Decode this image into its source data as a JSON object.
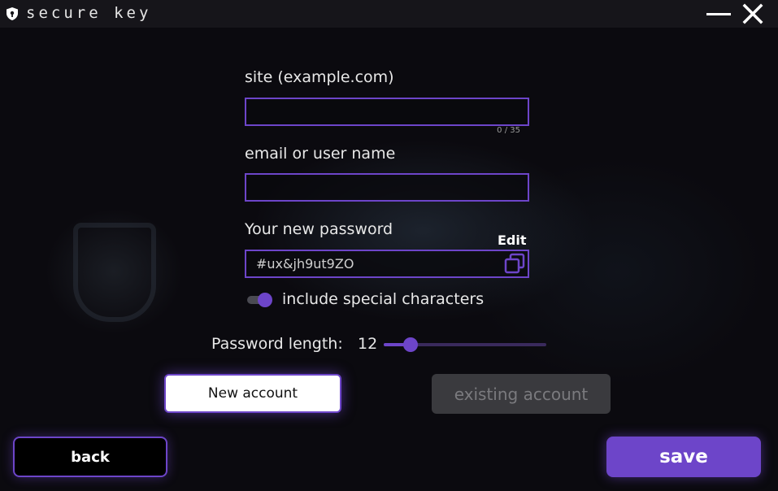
{
  "window": {
    "title": "secure key"
  },
  "form": {
    "site": {
      "label": "site (example.com)",
      "value": "",
      "placeholder": "",
      "counter": "0 / 35"
    },
    "username": {
      "label": "email or user name",
      "value": "",
      "placeholder": ""
    },
    "password": {
      "label": "Your new password",
      "value": "#ux&jh9ut9ZO",
      "edit_label": "Edit",
      "copy_icon": "copy-icon"
    },
    "special_chars": {
      "label": "include special characters",
      "enabled": true
    },
    "length": {
      "label": "Password length:",
      "value": "12",
      "min": 4,
      "max": 64,
      "current": 12
    }
  },
  "mode_buttons": {
    "new_label": "New account",
    "existing_label": "existing account",
    "selected": "new"
  },
  "footer": {
    "back_label": "back",
    "save_label": "save"
  },
  "icons": {
    "app": "shield-icon",
    "minimize": "minimize-icon",
    "close": "close-icon"
  },
  "colors": {
    "accent": "#6d45c9",
    "background": "#0b0a0f",
    "titlebar": "#16151a",
    "disabled": "#3a3a3e"
  }
}
